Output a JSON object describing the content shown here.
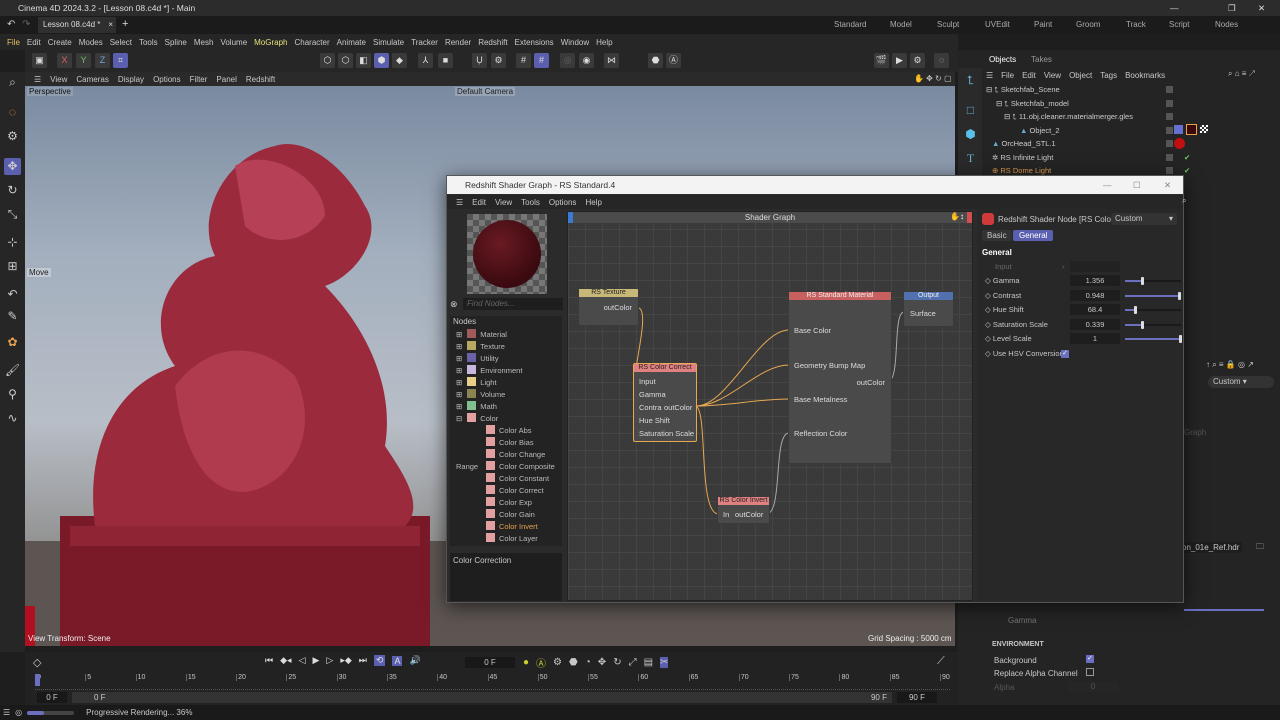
{
  "app": {
    "title": "Cinema 4D 2024.3.2 - [Lesson 08.c4d *] - Main",
    "doc_tab": "Lesson 08.c4d *"
  },
  "layouts": [
    "Standard",
    "Model",
    "Sculpt",
    "UVEdit",
    "Paint",
    "Groom",
    "Track",
    "Script",
    "Nodes"
  ],
  "menu": [
    "File",
    "Edit",
    "Create",
    "Modes",
    "Select",
    "Tools",
    "Spline",
    "Mesh",
    "Volume",
    "MoGraph",
    "Character",
    "Animate",
    "Simulate",
    "Tracker",
    "Render",
    "Redshift",
    "Extensions",
    "Window",
    "Help"
  ],
  "axes": {
    "x": "X",
    "y": "Y",
    "z": "Z"
  },
  "viewport": {
    "menu": [
      "View",
      "Cameras",
      "Display",
      "Options",
      "Filter",
      "Panel",
      "Redshift"
    ],
    "name": "Perspective",
    "camera": "Default Camera",
    "tool_label": "Move",
    "view_transform": "View Transform: Scene",
    "grid_spacing": "Grid Spacing : 5000 cm"
  },
  "objects": {
    "tabs": [
      "Objects",
      "Takes"
    ],
    "menu": [
      "File",
      "Edit",
      "View",
      "Object",
      "Tags",
      "Bookmarks"
    ],
    "items": [
      {
        "name": "Sketchfab_Scene"
      },
      {
        "name": "Sketchfab_model"
      },
      {
        "name": "11.obj.cleaner.materialmerger.gles"
      },
      {
        "name": "Object_2"
      },
      {
        "name": "OrcHead_STL.1"
      },
      {
        "name": "RS Infinite Light"
      },
      {
        "name": "RS Dome Light"
      }
    ]
  },
  "shader": {
    "title": "Redshift Shader Graph - RS Standard.4",
    "menu": [
      "Edit",
      "View",
      "Tools",
      "Options",
      "Help"
    ],
    "graph_title": "Shader Graph",
    "find_placeholder": "Find Nodes...",
    "nodes_header": "Nodes",
    "categories": [
      {
        "name": "Material",
        "color": "#a05a5a"
      },
      {
        "name": "Texture",
        "color": "#b8a860"
      },
      {
        "name": "Utility",
        "color": "#6a62a8"
      },
      {
        "name": "Environment",
        "color": "#c8b8e0"
      },
      {
        "name": "Light",
        "color": "#e8d088"
      },
      {
        "name": "Volume",
        "color": "#8a8450"
      },
      {
        "name": "Math",
        "color": "#80c090"
      },
      {
        "name": "Color",
        "color": "#e3a0a0"
      }
    ],
    "color_nodes": [
      "Color Abs",
      "Color Bias",
      "Color Change Range",
      "Color Composite",
      "Color Constant",
      "Color Correct",
      "Color Exp",
      "Color Gain",
      "Color Invert",
      "Color Layer"
    ],
    "description": "Color Correction",
    "graph_nodes": {
      "texture": {
        "title": "RS Texture",
        "out": "outColor"
      },
      "correct": {
        "title": "RS Color Correct",
        "ports": [
          "Input",
          "Gamma",
          "Contra",
          "Hue Shift",
          "Saturation Scale"
        ],
        "out": "outColor"
      },
      "material": {
        "title": "RS Standard Material",
        "ports": [
          "Base Color",
          "Geometry Bump Map",
          "Base Metalness",
          "Reflection Color"
        ],
        "out": "outColor"
      },
      "output": {
        "title": "Output",
        "port": "Surface"
      },
      "invert": {
        "title": "RS Color Invert",
        "in": "In",
        "out": "outColor"
      }
    },
    "attributes": {
      "node_title": "Redshift Shader Node [RS Color ...",
      "preset": "Custom",
      "tabs": [
        "Basic",
        "General"
      ],
      "section": "General",
      "input_label": "Input",
      "params": [
        {
          "label": "Gamma",
          "value": "1.356",
          "frac": 0.33
        },
        {
          "label": "Contrast",
          "value": "0.948",
          "frac": 0.98
        },
        {
          "label": "Hue Shift",
          "value": "68.4",
          "frac": 0.2
        },
        {
          "label": "Saturation Scale",
          "value": "0.339",
          "frac": 0.33
        },
        {
          "label": "Level Scale",
          "value": "1",
          "frac": 1.0
        }
      ],
      "hsv_label": "Use HSV Conversion"
    }
  },
  "bg_attr": {
    "preset": "Custom",
    "graph_btn": "Graph",
    "file": "on_01e_Ref.hdr",
    "gamma_label": "Gamma",
    "env_section": "ENVIRONMENT",
    "background": "Background",
    "replace_alpha": "Replace Alpha Channel",
    "alpha": "Alpha",
    "alpha_value": "0"
  },
  "timeline": {
    "current": "0 F",
    "ticks": [
      "0",
      "5",
      "10",
      "15",
      "20",
      "25",
      "30",
      "35",
      "40",
      "45",
      "50",
      "55",
      "60",
      "65",
      "70",
      "75",
      "80",
      "85",
      "90"
    ],
    "start": "0 F",
    "range_start": "0 F",
    "range_end": "90 F",
    "end": "90 F"
  },
  "status": {
    "text": "Progressive Rendering... 36%",
    "progress": 0.36
  }
}
